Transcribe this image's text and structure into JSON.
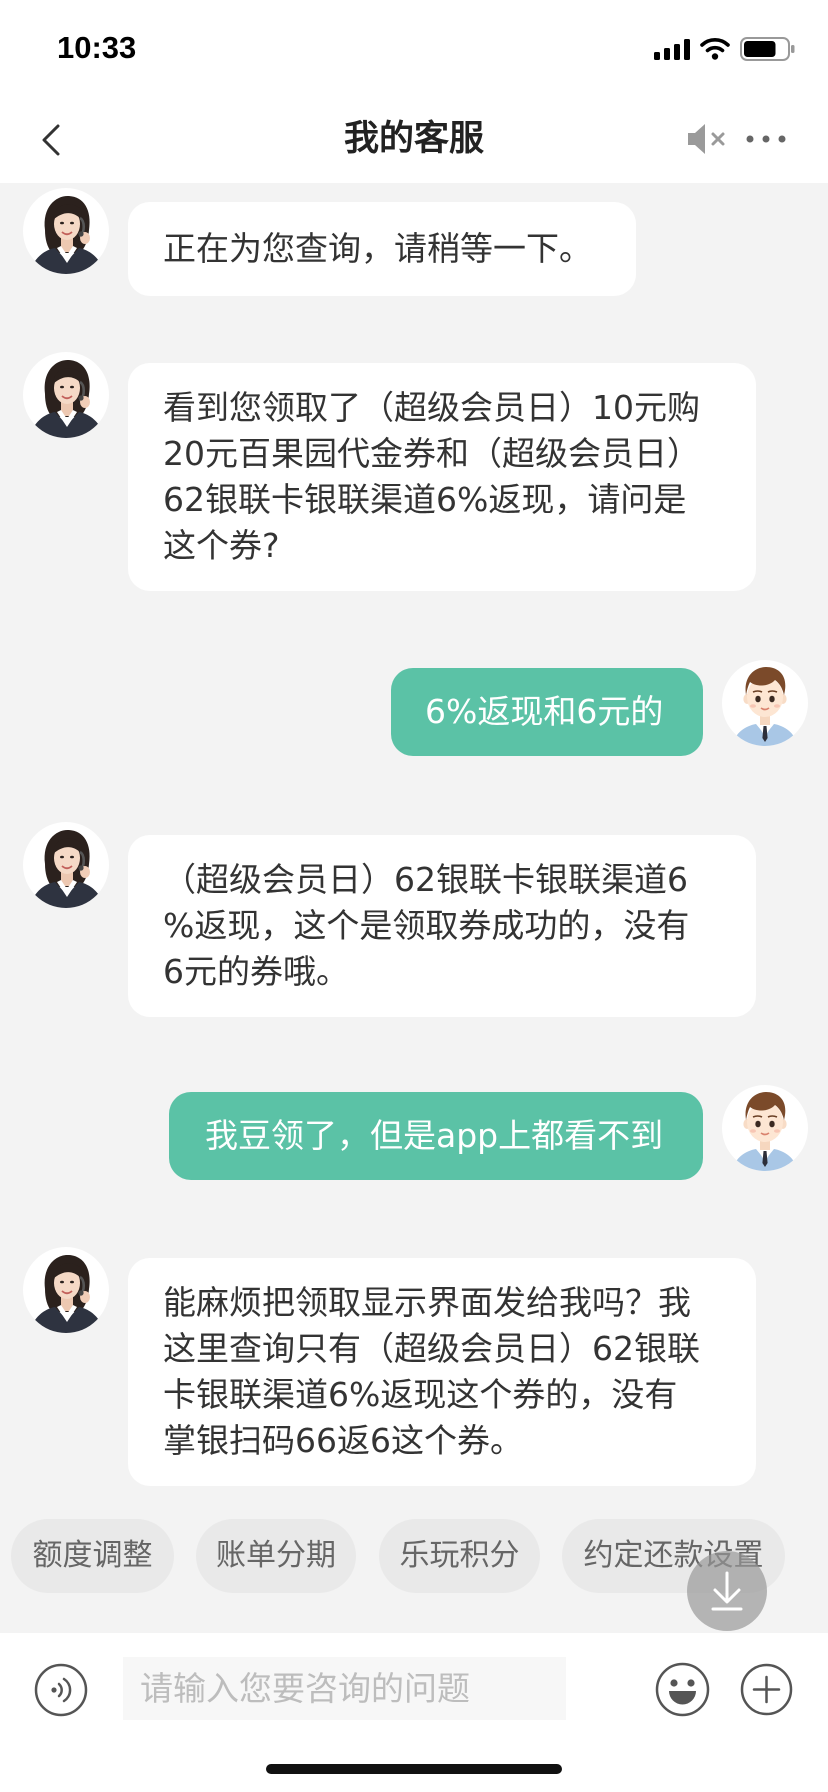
{
  "status_bar": {
    "time": "10:33",
    "signal_bars": 4,
    "battery_level": 0.75,
    "icons": {
      "signal": "signal-icon",
      "wifi": "wifi-icon",
      "battery": "battery-icon"
    }
  },
  "nav": {
    "title": "我的客服",
    "icons": {
      "back": "chevron-left-icon",
      "sound": "speaker-muted-icon",
      "more": "more-dots-icon"
    }
  },
  "messages": [
    {
      "outgoing": false,
      "avatar": "agent-avatar",
      "lines": [
        "正在为您查询，请稍等一下。"
      ]
    },
    {
      "outgoing": false,
      "avatar": "agent-avatar",
      "lines": [
        "看到您领取了（超级会员日）10元购",
        "20元百果园代金券和（超级会员日）",
        "62银联卡银联渠道6%返现，请问是",
        "这个券?"
      ]
    },
    {
      "outgoing": true,
      "avatar": "user-avatar",
      "lines": [
        "6%返现和6元的"
      ]
    },
    {
      "outgoing": false,
      "avatar": "agent-avatar",
      "lines": [
        "（超级会员日）62银联卡银联渠道6",
        "%返现，这个是领取券成功的，没有",
        "6元的券哦。"
      ]
    },
    {
      "outgoing": true,
      "avatar": "user-avatar",
      "lines": [
        "我豆领了，但是app上都看不到"
      ]
    },
    {
      "outgoing": false,
      "avatar": "agent-avatar",
      "lines": [
        "能麻烦把领取显示界面发给我吗？我",
        "这里查询只有（超级会员日）62银联",
        "卡银联渠道6%返现这个券的，没有",
        "掌银扫码66返6这个券。"
      ]
    }
  ],
  "quick_replies": [
    "额度调整",
    "账单分期",
    "乐玩积分",
    "约定还款设置"
  ],
  "scroll_button": {
    "icon": "arrow-down-icon"
  },
  "composer": {
    "placeholder": "请输入您要咨询的问题",
    "value": "",
    "icons": {
      "voice": "voice-icon",
      "emoji": "emoji-icon",
      "more": "plus-icon"
    }
  },
  "colors": {
    "chat_background": "#f3f3f3",
    "agent_bubble": "#ffffff",
    "user_bubble": "#5bc2a6",
    "quick_reply_chip": "#e9e9e9"
  }
}
